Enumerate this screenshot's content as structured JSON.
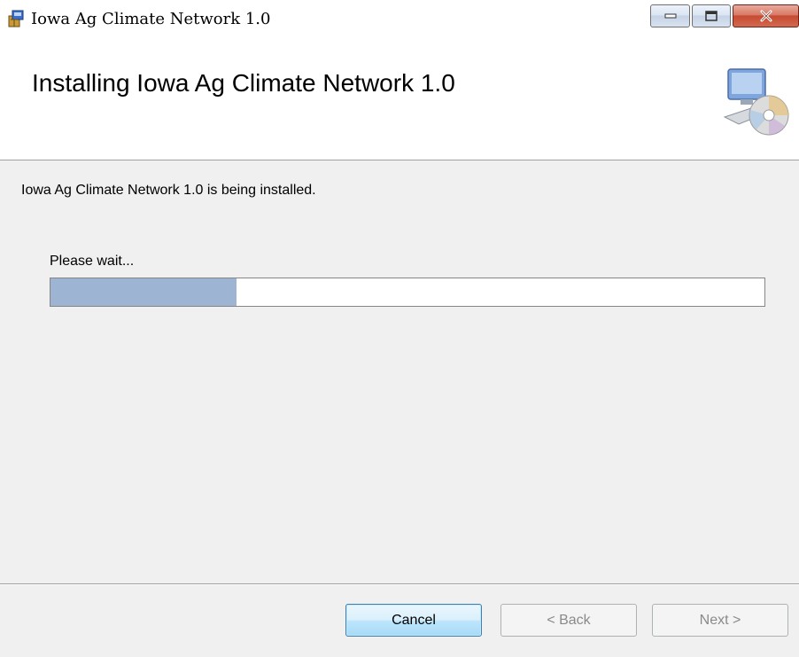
{
  "window": {
    "title": "Iowa Ag Climate Network 1.0",
    "app_icon": "installer-package-icon",
    "controls": {
      "minimize_icon": "minimize-icon",
      "maximize_icon": "maximize-icon",
      "close_icon": "close-icon"
    }
  },
  "banner": {
    "title": "Installing Iowa Ag Climate Network 1.0",
    "icon": "computer-cd-icon"
  },
  "body": {
    "status_text": "Iowa Ag Climate Network 1.0 is being installed.",
    "progress_label": "Please wait...",
    "progress_fraction": 0.26
  },
  "footer": {
    "cancel_label": "Cancel",
    "back_label": "< Back",
    "next_label": "Next >"
  },
  "colors": {
    "progress_fill": "#9db5d3",
    "window_bg": "#f0f0f0",
    "close_button": "#c74a32"
  }
}
